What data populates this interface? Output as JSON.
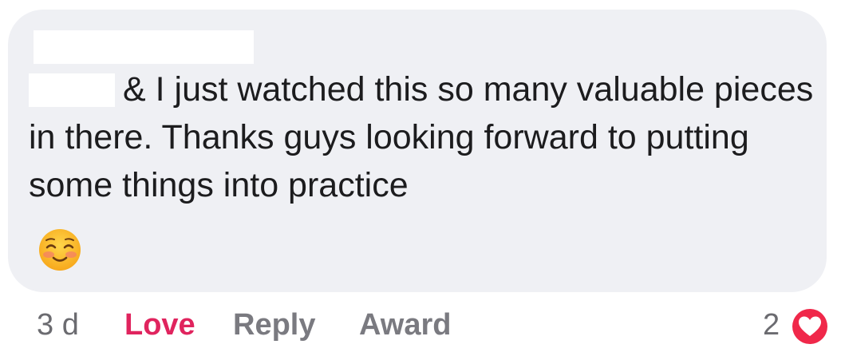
{
  "comment": {
    "text": "& I just watched this so many valuable pieces in there. Thanks guys looking forward to putting some things into practice",
    "emoji": "smiling-face-with-blush-icon"
  },
  "footer": {
    "timestamp": "3 d",
    "love_label": "Love",
    "reply_label": "Reply",
    "award_label": "Award",
    "reaction_count": "2",
    "reaction_icon": "heart-reaction-icon"
  },
  "colors": {
    "bubble": "#eff0f4",
    "love": "#e0245e",
    "heart_badge": "#f0284a"
  }
}
